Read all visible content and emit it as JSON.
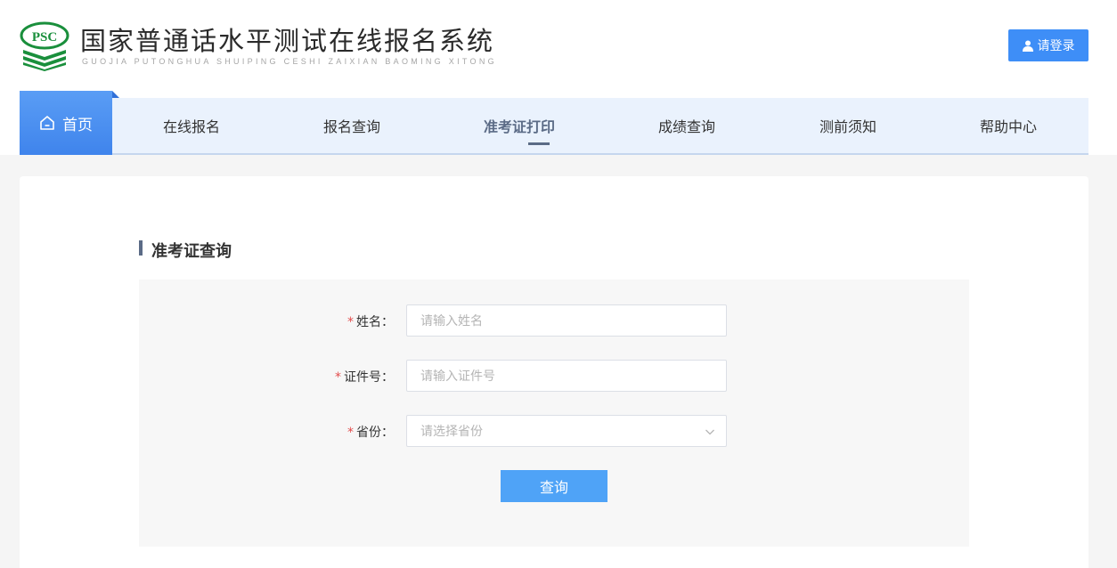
{
  "header": {
    "logo_text": "PSC",
    "title": "国家普通话水平测试在线报名系统",
    "subtitle": "GUOJIA PUTONGHUA SHUIPING CESHI ZAIXIAN BAOMING XITONG",
    "login_label": "请登录"
  },
  "nav": {
    "home_label": "首页",
    "items": [
      {
        "label": "在线报名"
      },
      {
        "label": "报名查询"
      },
      {
        "label": "准考证打印",
        "active": true
      },
      {
        "label": "成绩查询"
      },
      {
        "label": "测前须知"
      },
      {
        "label": "帮助中心"
      }
    ]
  },
  "section": {
    "title": "准考证查询"
  },
  "form": {
    "required_mark": "*",
    "name": {
      "label": "姓名：",
      "placeholder": "请输入姓名",
      "value": ""
    },
    "id_number": {
      "label": "证件号：",
      "placeholder": "请输入证件号",
      "value": ""
    },
    "province": {
      "label": "省份：",
      "placeholder": "请选择省份",
      "value": ""
    },
    "submit_label": "查询"
  },
  "colors": {
    "primary": "#3e8ef7",
    "nav_bg": "#eaf2fd",
    "active_nav": "#5b6b86",
    "required": "#e24c4c",
    "logo_green": "#1a8f3c"
  }
}
